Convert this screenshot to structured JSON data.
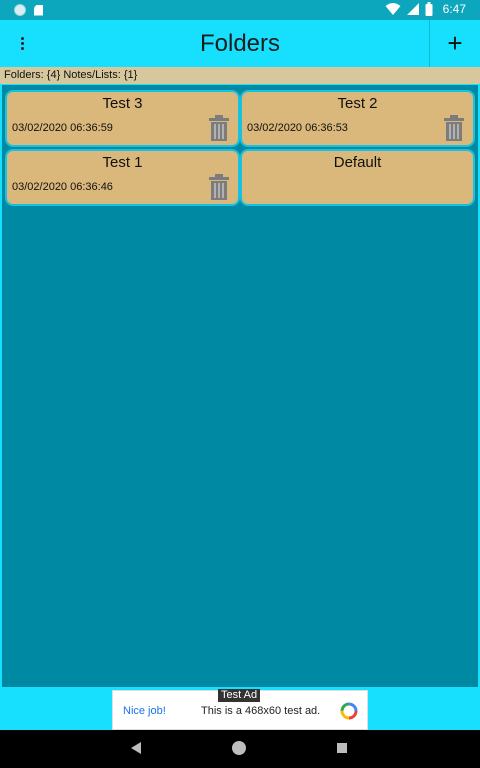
{
  "status_bar": {
    "time": "6:47"
  },
  "app_bar": {
    "title": "Folders",
    "add_label": "+"
  },
  "summary": {
    "text": "Folders: {4} Notes/Lists: {1}"
  },
  "folders": [
    {
      "name": "Test 3",
      "date": "03/02/2020 06:36:59",
      "deletable": true
    },
    {
      "name": "Test 2",
      "date": "03/02/2020 06:36:53",
      "deletable": true
    },
    {
      "name": "Test 1",
      "date": "03/02/2020 06:36:46",
      "deletable": true
    },
    {
      "name": "Default",
      "date": "",
      "deletable": false
    }
  ],
  "ad": {
    "label": "Test Ad",
    "nice": "Nice job!",
    "text": "This is a 468x60 test ad."
  },
  "colors": {
    "app_bar": "#17e0ff",
    "content_bg": "#0089a2",
    "card_bg": "#dab77a",
    "summary_bg": "#d7c79c"
  }
}
